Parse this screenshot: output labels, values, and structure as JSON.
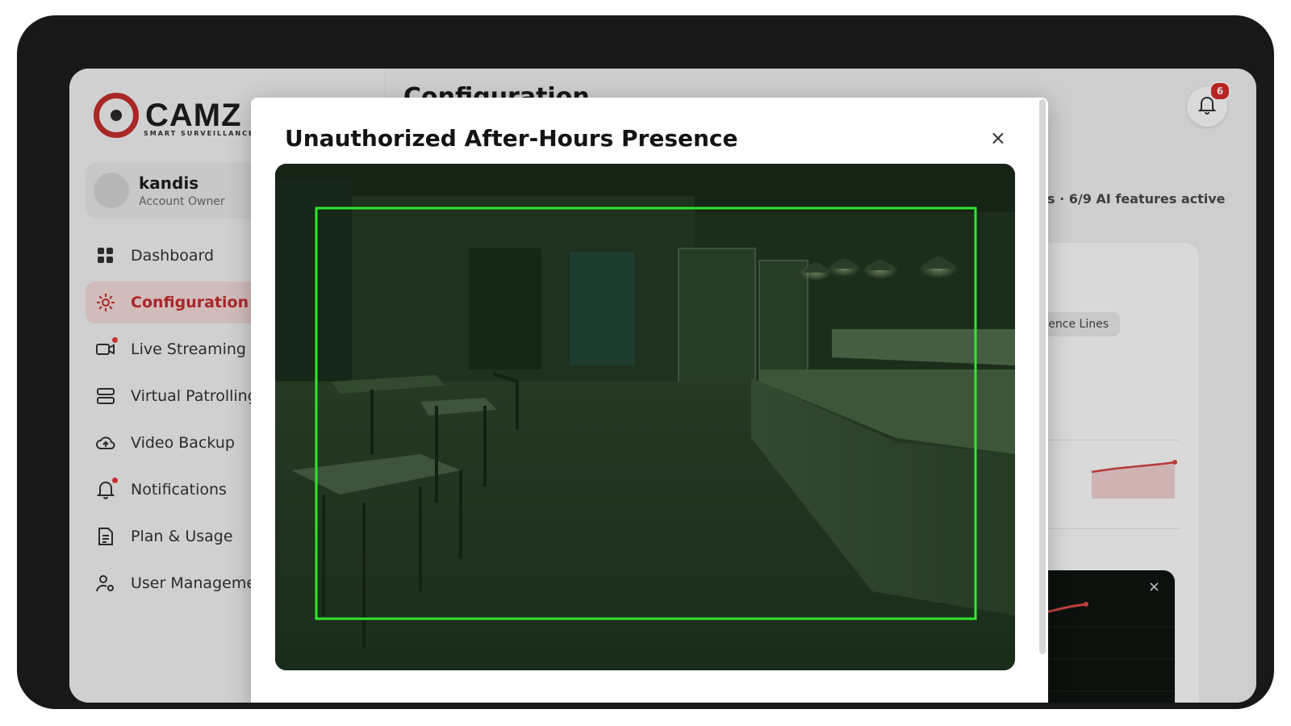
{
  "brand": {
    "logo_text": "CAMZ",
    "tagline": "SMART SURVEILLANCE, S"
  },
  "user": {
    "name": "kandis",
    "role": "Account Owner"
  },
  "sidebar": {
    "items": [
      {
        "label": "Dashboard",
        "icon": "dashboard-icon"
      },
      {
        "label": "Configuration",
        "icon": "gear-icon"
      },
      {
        "label": "Live Streaming",
        "icon": "camera-icon"
      },
      {
        "label": "Virtual Patrolling",
        "icon": "server-icon"
      },
      {
        "label": "Video Backup",
        "icon": "cloud-upload-icon"
      },
      {
        "label": "Notifications",
        "icon": "bell-icon"
      },
      {
        "label": "Plan & Usage",
        "icon": "document-icon"
      },
      {
        "label": "User Managemen",
        "icon": "user-settings-icon"
      }
    ],
    "active": "Configuration"
  },
  "header": {
    "title": "Configuration",
    "notification_count": "6"
  },
  "background_panel": {
    "ai_features_text": "s · 6/9 AI features active",
    "chip_label": "Fence Lines",
    "dark_panel_close": "×"
  },
  "modal": {
    "title": "Unauthorized After-Hours Presence",
    "close_label": "×",
    "image_label": "Restaurant dining room and kitchen counter camera frame with detection box",
    "detection_box_color": "#2ee82e"
  },
  "colors": {
    "accent": "#c62e2e",
    "active_bg": "#f6dcdc",
    "badge": "#d92b2b"
  }
}
